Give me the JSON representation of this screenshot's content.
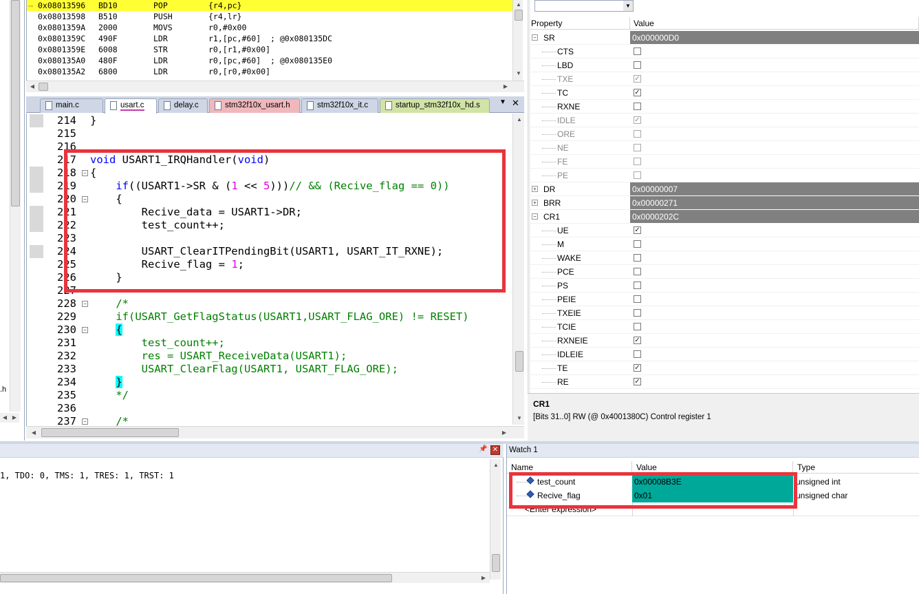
{
  "disassembly": [
    {
      "addr": "0x08013596",
      "hex": "BD10",
      "op": "POP",
      "args": "{r4,pc}",
      "current": true
    },
    {
      "addr": "0x08013598",
      "hex": "B510",
      "op": "PUSH",
      "args": "{r4,lr}"
    },
    {
      "addr": "0x0801359A",
      "hex": "2000",
      "op": "MOVS",
      "args": "r0,#0x00"
    },
    {
      "addr": "0x0801359C",
      "hex": "490F",
      "op": "LDR",
      "args": "r1,[pc,#60]  ; @0x080135DC"
    },
    {
      "addr": "0x0801359E",
      "hex": "6008",
      "op": "STR",
      "args": "r0,[r1,#0x00]"
    },
    {
      "addr": "0x080135A0",
      "hex": "480F",
      "op": "LDR",
      "args": "r0,[pc,#60]  ; @0x080135E0"
    },
    {
      "addr": "0x080135A2",
      "hex": "6800",
      "op": "LDR",
      "args": "r0,[r0,#0x00]"
    }
  ],
  "tabs": [
    {
      "label": "main.c",
      "color": "#cfd6e5"
    },
    {
      "label": "usart.c",
      "color": "#ffffff",
      "active": true
    },
    {
      "label": "delay.c",
      "color": "#cfd6e5"
    },
    {
      "label": "stm32f10x_usart.h",
      "color": "#f0b8bc"
    },
    {
      "label": "stm32f10x_it.c",
      "color": "#cfd6e5"
    },
    {
      "label": "startup_stm32f10x_hd.s",
      "color": "#d2e3a6"
    }
  ],
  "tabbar_controls": {
    "menu": "▼",
    "close": "✕"
  },
  "code_lines": [
    {
      "n": "214",
      "text": "}"
    },
    {
      "n": "215",
      "text": ""
    },
    {
      "n": "216",
      "text": ""
    },
    {
      "n": "217",
      "text": "void USART1_IRQHandler(void)"
    },
    {
      "n": "218",
      "text": "{"
    },
    {
      "n": "219",
      "text": "    if((USART1->SR & (1 << 5)))// && (Recive_flag == 0))"
    },
    {
      "n": "220",
      "text": "    {"
    },
    {
      "n": "221",
      "text": "        Recive_data = USART1->DR;"
    },
    {
      "n": "222",
      "text": "        test_count++;"
    },
    {
      "n": "223",
      "text": ""
    },
    {
      "n": "224",
      "text": "        USART_ClearITPendingBit(USART1, USART_IT_RXNE);"
    },
    {
      "n": "225",
      "text": "        Recive_flag = 1;"
    },
    {
      "n": "226",
      "text": "    }"
    },
    {
      "n": "227",
      "text": ""
    },
    {
      "n": "228",
      "text": "    /*"
    },
    {
      "n": "229",
      "text": "    if(USART_GetFlagStatus(USART1,USART_FLAG_ORE) != RESET)"
    },
    {
      "n": "230",
      "text": "    {"
    },
    {
      "n": "231",
      "text": "        test_count++;"
    },
    {
      "n": "232",
      "text": "        res = USART_ReceiveData(USART1);"
    },
    {
      "n": "233",
      "text": "        USART_ClearFlag(USART1, USART_FLAG_ORE);"
    },
    {
      "n": "234",
      "text": "    }"
    },
    {
      "n": "235",
      "text": "    */"
    },
    {
      "n": "236",
      "text": ""
    },
    {
      "n": "237",
      "text": "    /*"
    }
  ],
  "properties": {
    "header": {
      "property": "Property",
      "value": "Value"
    },
    "rows": [
      {
        "name": "SR",
        "value": "0x000000D0",
        "group": true,
        "expanded": true
      },
      {
        "name": "CTS",
        "check": false
      },
      {
        "name": "LBD",
        "check": false
      },
      {
        "name": "TXE",
        "check": true,
        "disabled": true
      },
      {
        "name": "TC",
        "check": true
      },
      {
        "name": "RXNE",
        "check": false
      },
      {
        "name": "IDLE",
        "check": true,
        "disabled": true
      },
      {
        "name": "ORE",
        "check": false,
        "disabled": true
      },
      {
        "name": "NE",
        "check": false,
        "disabled": true
      },
      {
        "name": "FE",
        "check": false,
        "disabled": true
      },
      {
        "name": "PE",
        "check": false,
        "disabled": true
      },
      {
        "name": "DR",
        "value": "0x00000007",
        "group": true,
        "expanded": false
      },
      {
        "name": "BRR",
        "value": "0x00000271",
        "group": true,
        "expanded": false
      },
      {
        "name": "CR1",
        "value": "0x0000202C",
        "group": true,
        "expanded": true
      },
      {
        "name": "UE",
        "check": true
      },
      {
        "name": "M",
        "check": false
      },
      {
        "name": "WAKE",
        "check": false
      },
      {
        "name": "PCE",
        "check": false
      },
      {
        "name": "PS",
        "check": false
      },
      {
        "name": "PEIE",
        "check": false
      },
      {
        "name": "TXEIE",
        "check": false
      },
      {
        "name": "TCIE",
        "check": false
      },
      {
        "name": "RXNEIE",
        "check": true
      },
      {
        "name": "IDLEIE",
        "check": false
      },
      {
        "name": "TE",
        "check": true
      },
      {
        "name": "RE",
        "check": true
      }
    ]
  },
  "description": {
    "title": "CR1",
    "text": "[Bits 31..0] RW (@ 0x4001380C) Control register 1"
  },
  "command": {
    "text": "1, TDO: 0, TMS: 1, TRES: 1, TRST: 1"
  },
  "left_stub": {
    "text": ".h"
  },
  "pin_controls": {
    "pin": "📌",
    "close": "✕"
  },
  "watch": {
    "title": "Watch 1",
    "columns": [
      "Name",
      "Value",
      "Type"
    ],
    "rows": [
      {
        "name": "test_count",
        "value": "0x00008B3E",
        "type": "unsigned int"
      },
      {
        "name": "Recive_flag",
        "value": "0x01",
        "type": "unsigned char"
      }
    ],
    "enter": "<Enter expression>"
  }
}
